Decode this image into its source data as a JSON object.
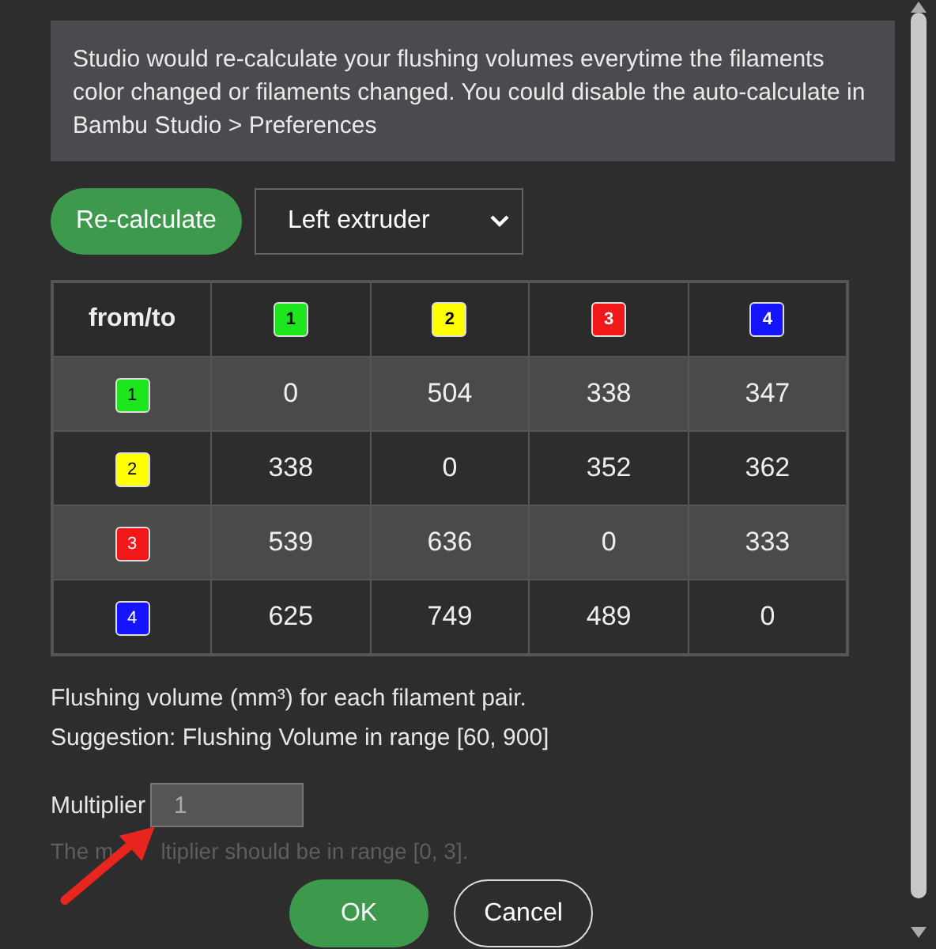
{
  "info": "Studio would re-calculate your flushing volumes everytime the filaments color changed or filaments changed. You could disable the auto-calculate in Bambu Studio > Preferences",
  "recalculate_button": "Re-calculate",
  "extruder_select": {
    "value": "Left extruder"
  },
  "table": {
    "corner": "from/to",
    "filaments": [
      {
        "label": "1",
        "color": "#1ee61e"
      },
      {
        "label": "2",
        "color": "#ffff00"
      },
      {
        "label": "3",
        "color": "#f01818"
      },
      {
        "label": "4",
        "color": "#1414ff"
      }
    ],
    "rows": [
      {
        "label": "1",
        "color": "#1ee61e",
        "values": [
          "0",
          "504",
          "338",
          "347"
        ]
      },
      {
        "label": "2",
        "color": "#ffff00",
        "values": [
          "338",
          "0",
          "352",
          "362"
        ]
      },
      {
        "label": "3",
        "color": "#f01818",
        "values": [
          "539",
          "636",
          "0",
          "333"
        ]
      },
      {
        "label": "4",
        "color": "#1414ff",
        "values": [
          "625",
          "749",
          "489",
          "0"
        ]
      }
    ]
  },
  "note": "Flushing volume (mm³) for each filament pair.",
  "suggestion": "Suggestion: Flushing Volume in range [60, 900]",
  "multiplier": {
    "label": "Multiplier",
    "value": "1",
    "hint_parts": [
      "The m",
      "ltiplier should be in range [0, 3]."
    ]
  },
  "buttons": [
    {
      "label": "OK",
      "kind": "primary"
    },
    {
      "label": "Cancel",
      "kind": "secondary"
    }
  ]
}
